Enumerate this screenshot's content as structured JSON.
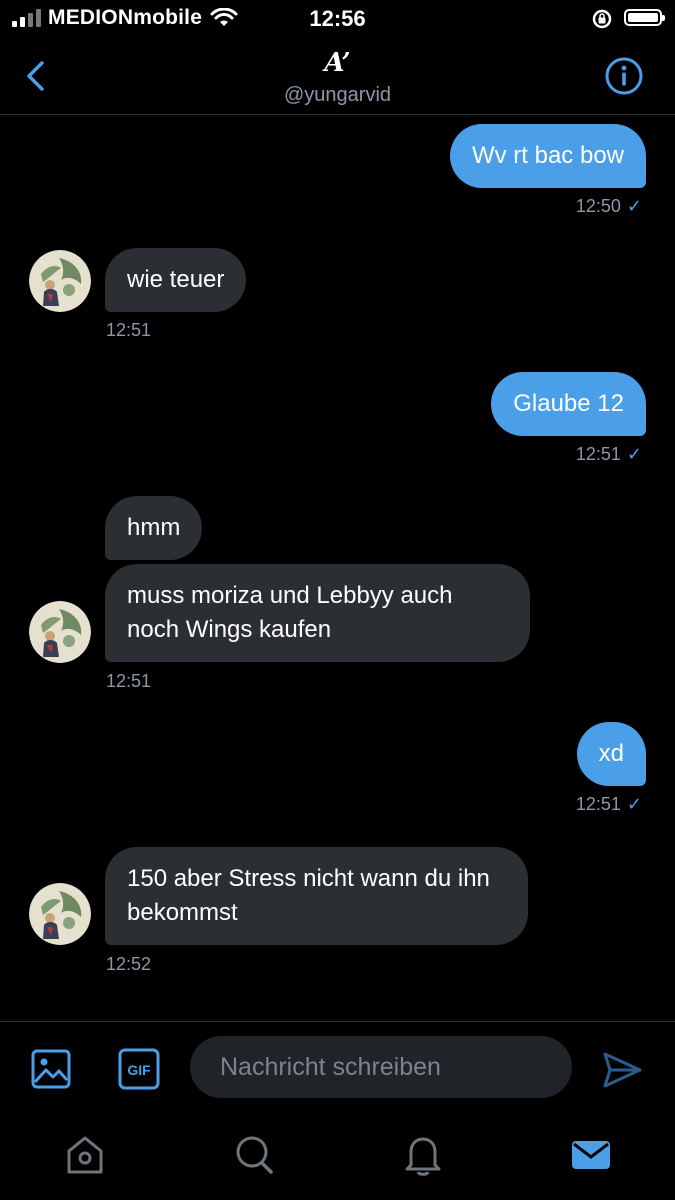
{
  "status": {
    "carrier": "MEDIONmobile",
    "time": "12:56"
  },
  "header": {
    "title": "A’",
    "handle": "@yungarvid"
  },
  "messages": [
    {
      "side": "sent",
      "text": "Wv rt bac bow",
      "time": "12:50"
    },
    {
      "side": "received",
      "text": "wie teuer",
      "time": "12:51"
    },
    {
      "side": "sent",
      "text": "Glaube 12",
      "time": "12:51"
    },
    {
      "side": "received",
      "text": "hmm"
    },
    {
      "side": "received",
      "text": "muss moriza und Lebbyy auch noch Wings kaufen",
      "time": "12:51"
    },
    {
      "side": "sent",
      "text": "xd",
      "time": "12:51"
    },
    {
      "side": "received",
      "text": "150 aber Stress nicht wann du ihn bekommst",
      "time": "12:52"
    }
  ],
  "composer": {
    "placeholder": "Nachricht schreiben",
    "gif_label": "GIF"
  },
  "tabs": [
    "home-tab",
    "search-tab",
    "notifications-tab",
    "messages-tab"
  ],
  "colors": {
    "accent": "#4a9fe8",
    "received_bubble": "#2b2e32",
    "background": "#000000"
  }
}
